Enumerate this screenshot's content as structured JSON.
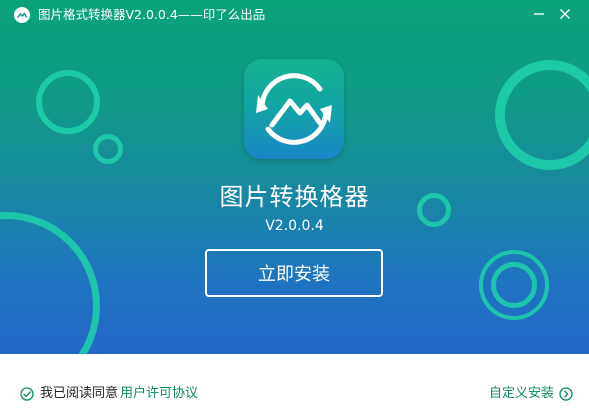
{
  "window": {
    "title": "图片格式转换器V2.0.0.4——印了么出品",
    "minimize_icon": "minimize-icon",
    "close_icon": "close-icon"
  },
  "app": {
    "name": "图片转换格器",
    "version": "V2.0.0.4",
    "icon": "refresh-mountain-icon"
  },
  "actions": {
    "install_label": "立即安装"
  },
  "footer": {
    "agree_text": "我已阅读同意",
    "license_link": "用户许可协议",
    "custom_install": "自定义安装"
  },
  "colors": {
    "gradient_top": "#0aa37a",
    "gradient_bottom": "#2368c8",
    "ring": "#19c6a0",
    "link_green": "#0d8a5f"
  }
}
